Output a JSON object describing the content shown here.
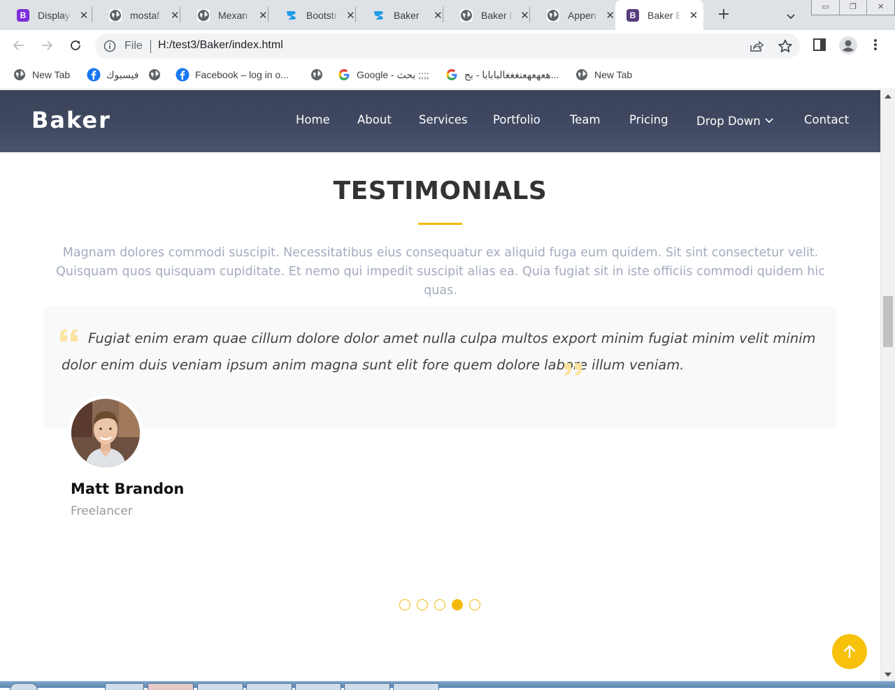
{
  "browser": {
    "tabs": [
      {
        "title": "Display",
        "favicon": "bootstrap-icon",
        "active": false
      },
      {
        "title": "mostaf",
        "favicon": "globe-icon",
        "active": false
      },
      {
        "title": "Mexan",
        "favicon": "globe-icon",
        "active": false
      },
      {
        "title": "Bootstr",
        "favicon": "bz-logo-icon",
        "active": false
      },
      {
        "title": "Baker",
        "favicon": "bz-logo-icon",
        "active": false
      },
      {
        "title": "Baker B",
        "favicon": "globe-icon",
        "active": false
      },
      {
        "title": "Appen",
        "favicon": "globe-icon",
        "active": false
      },
      {
        "title": "Baker B",
        "favicon": "bootstrap-icon",
        "active": true
      }
    ],
    "omnibox": {
      "scheme_label": "File",
      "url": "H:/test3/Baker/index.html"
    },
    "bookmarks": [
      {
        "label": "New Tab",
        "icon": "globe-icon"
      },
      {
        "label": "فيسبوك",
        "icon": "facebook-icon"
      },
      {
        "label": "",
        "icon": "globe-icon"
      },
      {
        "label": "Facebook – log in o...",
        "icon": "facebook-icon"
      },
      {
        "label": "",
        "icon": "globe-icon"
      },
      {
        "label": "Google - بحث ;;;;",
        "icon": "google-icon"
      },
      {
        "label": "هعهعهعنغغغالبابابا - بح...",
        "icon": "google-icon"
      },
      {
        "label": "New Tab",
        "icon": "globe-icon"
      }
    ]
  },
  "site": {
    "logo": "Baker",
    "nav": [
      "Home",
      "About",
      "Services",
      "Portfolio",
      "Team",
      "Pricing",
      "Drop Down",
      "Contact"
    ],
    "colors": {
      "accent": "#f0b90a",
      "header": "#3f4860"
    }
  },
  "testimonials": {
    "title": "TESTIMONIALS",
    "description": "Magnam dolores commodi suscipit. Necessitatibus eius consequatur ex aliquid fuga eum quidem. Sit sint consectetur velit. Quisquam quos quisquam cupiditate. Et nemo qui impedit suscipit alias ea. Quia fugiat sit in iste officiis commodi quidem hic quas.",
    "quote": "Fugiat enim eram quae cillum dolore dolor amet nulla culpa multos export minim fugiat minim velit minim dolor enim duis veniam ipsum anim magna sunt elit fore quem dolore labore illum veniam.",
    "person": {
      "name": "Matt Brandon",
      "role": "Freelancer"
    },
    "slider": {
      "total": 5,
      "active_index": 3
    }
  }
}
